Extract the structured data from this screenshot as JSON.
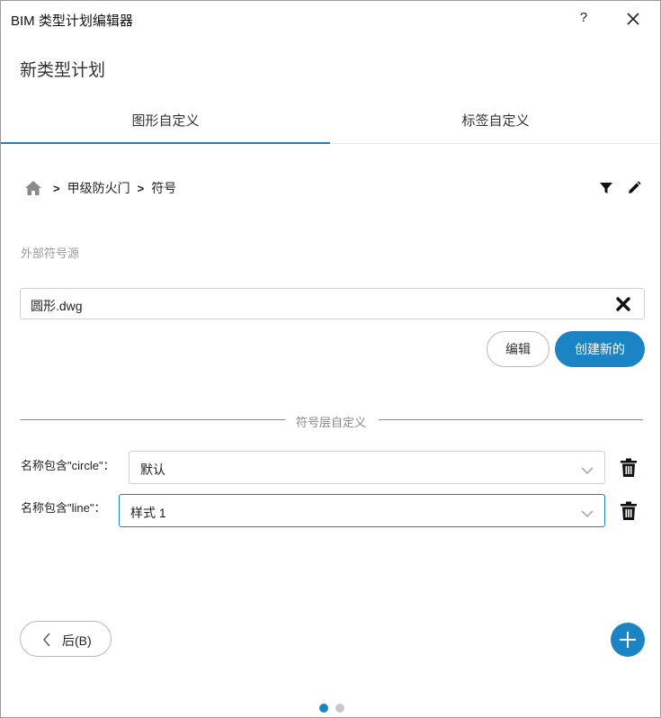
{
  "window": {
    "title": "BIM 类型计划编辑器",
    "help_label": "?"
  },
  "page": {
    "title": "新类型计划"
  },
  "tabs": [
    {
      "label": "图形自定义",
      "active": true
    },
    {
      "label": "标签自定义",
      "active": false
    }
  ],
  "breadcrumb": {
    "separator": ">",
    "items": [
      "甲级防火门",
      "符号"
    ]
  },
  "icons": {
    "home": "home-icon",
    "filter": "filter-icon",
    "edit": "pencil-icon",
    "clear": "x-icon",
    "delete": "trash-icon",
    "add": "plus-icon",
    "back": "chevron-left-icon",
    "help": "question-icon",
    "close": "close-icon"
  },
  "external_source": {
    "label": "外部符号源",
    "file_value": "圆形.dwg"
  },
  "actions": {
    "edit_label": "编辑",
    "create_label": "创建新的"
  },
  "layer_section": {
    "title": "符号层自定义",
    "rows": [
      {
        "label": "名称包含\"circle\"：",
        "value": "默认"
      },
      {
        "label": "名称包含\"line\"：",
        "value": "样式 1"
      }
    ]
  },
  "footer": {
    "back_label": "后(B)",
    "page_count": 2,
    "current_page": 1
  },
  "colors": {
    "accent": "#1a84c4",
    "dot_inactive": "#c8c8c8",
    "icon_dark": "#111111",
    "home_icon": "#8a8a8a"
  }
}
